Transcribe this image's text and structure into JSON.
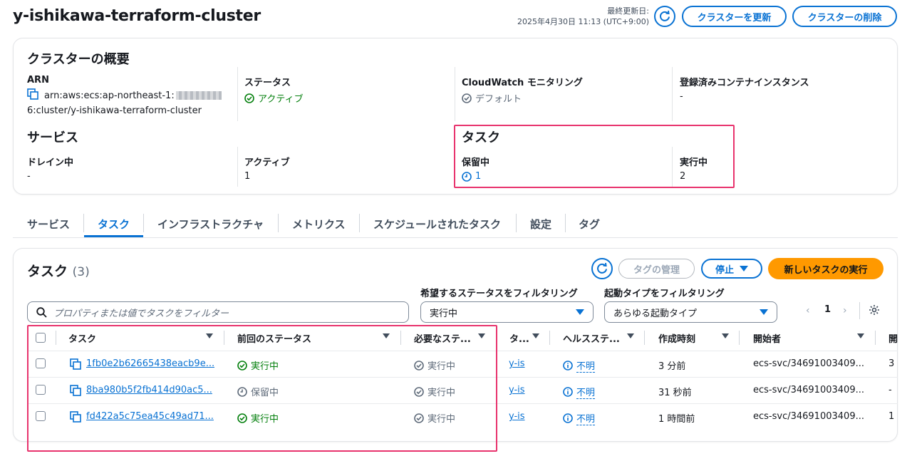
{
  "header": {
    "title": "y-ishikawa-terraform-cluster",
    "updated_label": "最終更新日:",
    "updated_value": "2025年4月30日 11:13 (UTC+9:00)",
    "update_button": "クラスターを更新",
    "delete_button": "クラスターの削除"
  },
  "overview": {
    "heading": "クラスターの概要",
    "arn_label": "ARN",
    "arn_line1": "arn:aws:ecs:ap-northeast-1:",
    "arn_line2": "6:cluster/y-ishikawa-terraform-cluster",
    "status_label": "ステータス",
    "status_value": "アクティブ",
    "cloudwatch_label": "CloudWatch モニタリング",
    "cloudwatch_value": "デフォルト",
    "instances_label": "登録済みコンテナインスタンス",
    "instances_value": "-",
    "services_heading": "サービス",
    "draining_label": "ドレイン中",
    "draining_value": "-",
    "active_label": "アクティブ",
    "active_value": "1",
    "tasks_heading": "タスク",
    "pending_label": "保留中",
    "pending_value": "1",
    "running_label": "実行中",
    "running_value": "2"
  },
  "tabs": [
    "サービス",
    "タスク",
    "インフラストラクチャ",
    "メトリクス",
    "スケジュールされたタスク",
    "設定",
    "タグ"
  ],
  "tasks": {
    "heading": "タスク",
    "count": "(3)",
    "manage_tags": "タグの管理",
    "stop": "停止",
    "run_new": "新しいタスクの実行",
    "search_placeholder": "プロパティまたは値でタスクをフィルター",
    "desired_status_label": "希望するステータスをフィルタリング",
    "desired_status_value": "実行中",
    "launch_type_label": "起動タイプをフィルタリング",
    "launch_type_value": "あらゆる起動タイプ",
    "page": "1",
    "columns": [
      "タスク",
      "前回のステータス",
      "必要なステ...",
      "タ...",
      "ヘルスステ...",
      "作成時刻",
      "開始者",
      "開"
    ],
    "rows": [
      {
        "task": "1fb0e2b62665438eacb9e...",
        "last_status": "実行中",
        "desired": "実行中",
        "taskdef": "y-is",
        "health": "不明",
        "created": "3 分前",
        "started_by": "ecs-svc/34691003409...",
        "extra": "3"
      },
      {
        "task": "8ba980b5f2fb414d90ac5...",
        "last_status": "保留中",
        "desired": "実行中",
        "taskdef": "y-is",
        "health": "不明",
        "created": "31 秒前",
        "started_by": "ecs-svc/34691003409...",
        "extra": "-"
      },
      {
        "task": "fd422a5c75ea45c49ad71...",
        "last_status": "実行中",
        "desired": "実行中",
        "taskdef": "y-is",
        "health": "不明",
        "created": "1 時間前",
        "started_by": "ecs-svc/34691003409...",
        "extra": "1"
      }
    ]
  },
  "colors": {
    "accent": "#0972d3",
    "primary_button": "#ff9900",
    "success": "#037f0c",
    "highlight": "#e8336d"
  }
}
